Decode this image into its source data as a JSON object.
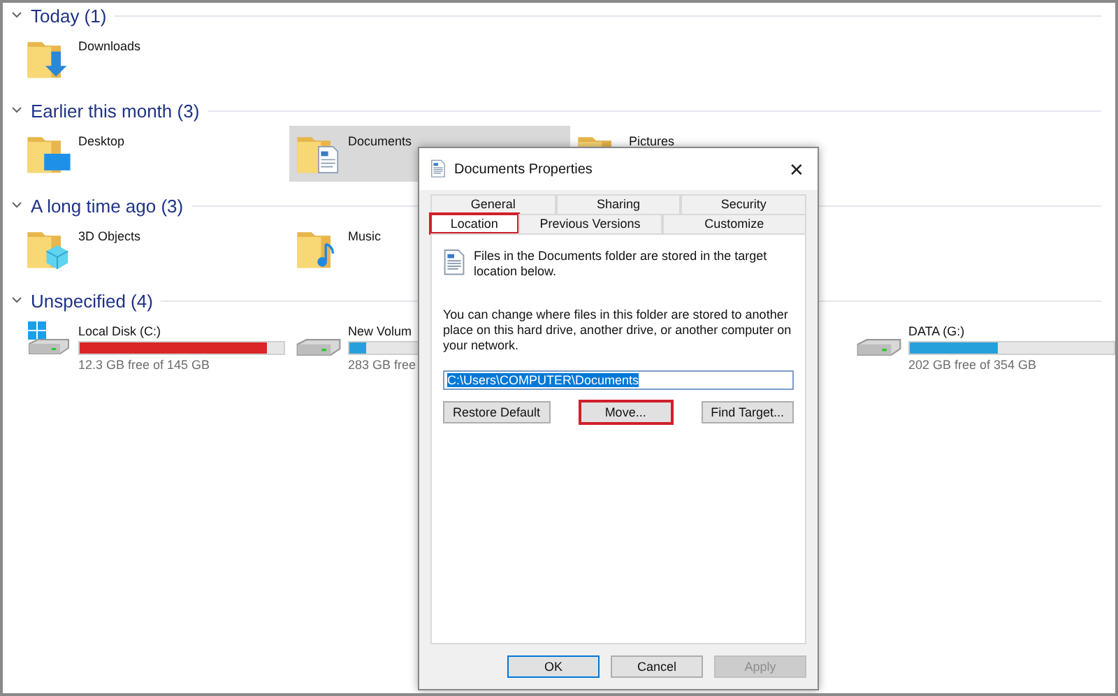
{
  "groups": [
    {
      "title": "Today (1)",
      "items": [
        {
          "kind": "downloads",
          "label": "Downloads",
          "selected": false
        }
      ]
    },
    {
      "title": "Earlier this month (3)",
      "items": [
        {
          "kind": "desktop",
          "label": "Desktop",
          "selected": false
        },
        {
          "kind": "documents",
          "label": "Documents",
          "selected": true
        },
        {
          "kind": "pictures",
          "label": "Pictures",
          "selected": false
        }
      ]
    },
    {
      "title": "A long time ago (3)",
      "items": [
        {
          "kind": "objects",
          "label": "3D Objects",
          "selected": false
        },
        {
          "kind": "music",
          "label": "Music",
          "selected": false
        }
      ]
    },
    {
      "title": "Unspecified (4)",
      "items": [
        {
          "kind": "systemdrive",
          "label": "Local Disk (C:)",
          "level": 0.92,
          "low": true,
          "free": "12.3 GB free of 145 GB"
        },
        {
          "kind": "drive",
          "label": "New Volum",
          "level": 0.08,
          "low": false,
          "free": "283 GB free"
        },
        {
          "kind": "empty"
        },
        {
          "kind": "drive",
          "label": "DATA (G:)",
          "level": 0.43,
          "low": false,
          "free": "202 GB free of 354 GB"
        }
      ]
    }
  ],
  "dialog": {
    "title": "Documents Properties",
    "close": "✕",
    "tab_rows": [
      [
        {
          "label": "General",
          "selected": false,
          "highlighted": false
        },
        {
          "label": "Sharing",
          "selected": false,
          "highlighted": false
        },
        {
          "label": "Security",
          "selected": false,
          "highlighted": false
        }
      ],
      [
        {
          "label": "Location",
          "selected": true,
          "highlighted": true
        },
        {
          "label": "Previous Versions",
          "selected": false,
          "highlighted": false
        },
        {
          "label": "Customize",
          "selected": false,
          "highlighted": false
        }
      ]
    ],
    "intro": "Files in the Documents folder are stored in the target location below.",
    "explanation": "You can change where files in this folder are stored to another place on this hard drive, another drive, or another computer on your network.",
    "path": "C:\\Users\\COMPUTER\\Documents",
    "actions": [
      {
        "label": "Restore Default",
        "highlighted": false
      },
      {
        "label": "Move...",
        "highlighted": true
      },
      {
        "label": "Find Target...",
        "highlighted": false
      }
    ],
    "buttons": [
      {
        "label": "OK",
        "default": true,
        "disabled": false
      },
      {
        "label": "Cancel",
        "default": false,
        "disabled": false
      },
      {
        "label": "Apply",
        "default": false,
        "disabled": true
      }
    ]
  }
}
